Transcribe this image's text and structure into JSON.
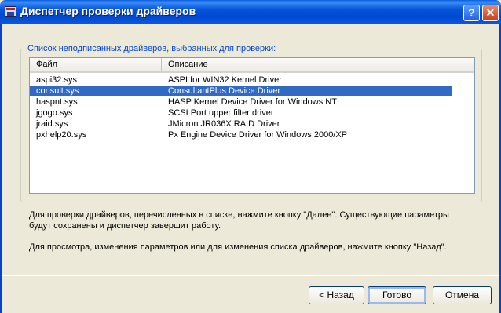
{
  "window": {
    "title": "Диспетчер проверки драйверов",
    "help_label": "?",
    "close_label": "✕"
  },
  "group": {
    "label": "Список неподписанных драйверов, выбранных для проверки:"
  },
  "list": {
    "columns": [
      "Файл",
      "Описание"
    ],
    "rows": [
      {
        "file": "aspi32.sys",
        "description": "ASPI for WIN32 Kernel Driver",
        "selected": false
      },
      {
        "file": "consult.sys",
        "description": "ConsultantPlus Device Driver",
        "selected": true
      },
      {
        "file": "haspnt.sys",
        "description": "HASP Kernel Device Driver for Windows NT",
        "selected": false
      },
      {
        "file": "jgogo.sys",
        "description": "SCSI Port upper filter driver",
        "selected": false
      },
      {
        "file": "jraid.sys",
        "description": "JMicron JR036X RAID Driver",
        "selected": false
      },
      {
        "file": "pxhelp20.sys",
        "description": "Px Engine Device Driver for Windows 2000/XP",
        "selected": false
      }
    ]
  },
  "info": {
    "paragraph1_line1": "Для проверки драйверов, перечисленных в списке, нажмите кнопку \"Далее\". Существующие параметры",
    "paragraph1_line2": "будут сохранены и диспетчер завершит работу.",
    "paragraph2": "Для просмотра, изменения параметров или для изменения списка драйверов, нажмите кнопку \"Назад\"."
  },
  "buttons": {
    "back": "< Назад",
    "next": "Готово",
    "cancel": "Отмена"
  },
  "colors": {
    "selection": "#316ac5",
    "titlebar": "#0054e3",
    "group_label": "#0046d5"
  }
}
